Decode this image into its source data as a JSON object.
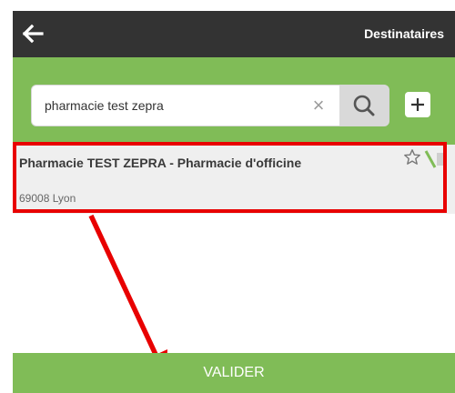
{
  "header": {
    "title": "Destinataires",
    "back_icon": "arrow-left-icon"
  },
  "search": {
    "value": "pharmacie test zepra",
    "clear_icon": "close-icon",
    "search_icon": "search-icon",
    "add_icon": "plus-icon"
  },
  "results": [
    {
      "title": "Pharmacie TEST ZEPRA - Pharmacie d'officine",
      "location": "69008 Lyon",
      "favorite_icon": "star-outline-icon"
    }
  ],
  "footer": {
    "validate_label": "VALIDER"
  },
  "annotation": {
    "highlight_color": "#e80000"
  },
  "colors": {
    "header_bg": "#333333",
    "accent_green": "#80bc57",
    "result_bg": "#efefef"
  }
}
